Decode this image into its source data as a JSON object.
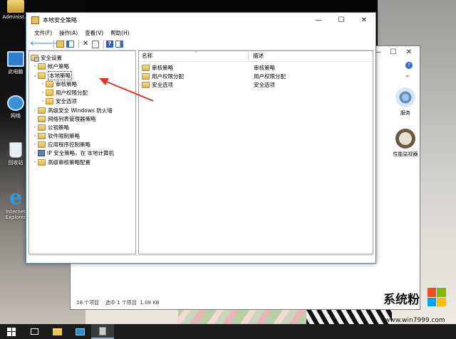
{
  "desktop": {
    "icons": [
      {
        "label": "Administ..."
      },
      {
        "label": "此电脑"
      },
      {
        "label": "网络"
      },
      {
        "label": "回收站"
      },
      {
        "label": "Internet Explorer"
      }
    ]
  },
  "background_window": {
    "items": [
      "服务",
      "性能监视器"
    ],
    "status": "18 个项目    选中 1 个项目  1.09 KB",
    "help": "?"
  },
  "window": {
    "title": "本地安全策略",
    "buttons": {
      "minimize": "—",
      "maximize": "☐",
      "close": "✕"
    },
    "menu": [
      "文件(F)",
      "操作(A)",
      "查看(V)",
      "帮助(H)"
    ],
    "toolbar_glyphs": {
      "back": "🡐",
      "forward": "🡒",
      "delete": "✕",
      "help": "?"
    },
    "tree": {
      "twisty_collapsed": "›",
      "twisty_expanded": "⌄",
      "root": "安全设置",
      "nodes": [
        {
          "label": "帐户策略",
          "expanded": false
        },
        {
          "label": "本地策略",
          "expanded": true,
          "selected": true
        },
        {
          "label": "审核策略",
          "expanded": false
        },
        {
          "label": "用户权限分配",
          "expanded": false
        },
        {
          "label": "安全选项",
          "expanded": false
        },
        {
          "label": "高级安全 Windows 防火墙",
          "expanded": false
        },
        {
          "label": "网络列表管理器策略",
          "expanded": false
        },
        {
          "label": "公钥策略",
          "expanded": false
        },
        {
          "label": "软件限制策略",
          "expanded": false
        },
        {
          "label": "应用程序控制策略",
          "expanded": false
        },
        {
          "label": "IP 安全策略，在 本地计算机",
          "expanded": false
        },
        {
          "label": "高级审核策略配置",
          "expanded": false
        }
      ]
    },
    "list": {
      "columns": {
        "name": "名称",
        "description": "描述"
      },
      "sort_glyph": "^",
      "rows": [
        {
          "name": "审核策略",
          "description": "审核策略"
        },
        {
          "name": "用户权限分配",
          "description": "用户权限分配"
        },
        {
          "name": "安全选项",
          "description": "安全选项"
        }
      ]
    }
  },
  "taskbar": {
    "items": [
      "start-button",
      "task-view-button",
      "file-explorer",
      "remote-desktop",
      "local-security-policy"
    ]
  },
  "watermark": {
    "text": "系统粉",
    "url": "www.win7999.com"
  },
  "colors": {
    "accent": "#2f6fbf",
    "taskbar": "#1c1c1c",
    "folder": "#ddb548",
    "annotation_arrow": "#e0352b"
  }
}
